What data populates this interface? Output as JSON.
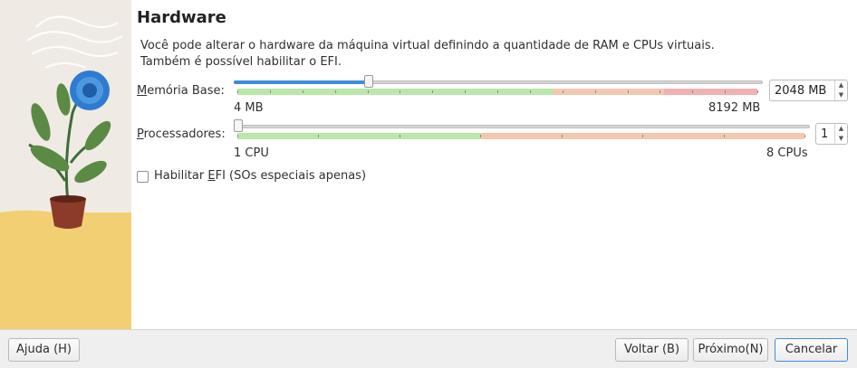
{
  "page": {
    "title": "Hardware",
    "description_line1": "Você pode alterar o hardware da máquina virtual definindo a quantidade de RAM e CPUs virtuais.",
    "description_line2": "Também é possível habilitar o EFI."
  },
  "memory": {
    "label_prefix": "M",
    "label_rest": "emória Base:",
    "min_label": "4 MB",
    "max_label": "8192 MB",
    "value": "2048 MB",
    "fraction": 0.25
  },
  "cpu": {
    "label_prefix": "P",
    "label_rest": "rocessadores:",
    "min_label": "1 CPU",
    "max_label": "8 CPUs",
    "value": "1",
    "fraction": 0
  },
  "efi": {
    "label_before": "Habilitar ",
    "label_mnemonic": "E",
    "label_after": "FI (SOs especiais apenas)",
    "checked": false
  },
  "buttons": {
    "help": "Ajuda (H)",
    "back": "Voltar (B)",
    "next": "Próximo(N)",
    "cancel": "Cancelar"
  },
  "colors": {
    "accent": "#3d8ed8",
    "zone_ok": "#b9e8a9",
    "zone_warn": "#f4c7af",
    "zone_bad": "#f2b0b2"
  },
  "icons": {
    "spin_up": "chevron-up-icon",
    "spin_down": "chevron-down-icon",
    "illustration": "plant-illustration"
  }
}
